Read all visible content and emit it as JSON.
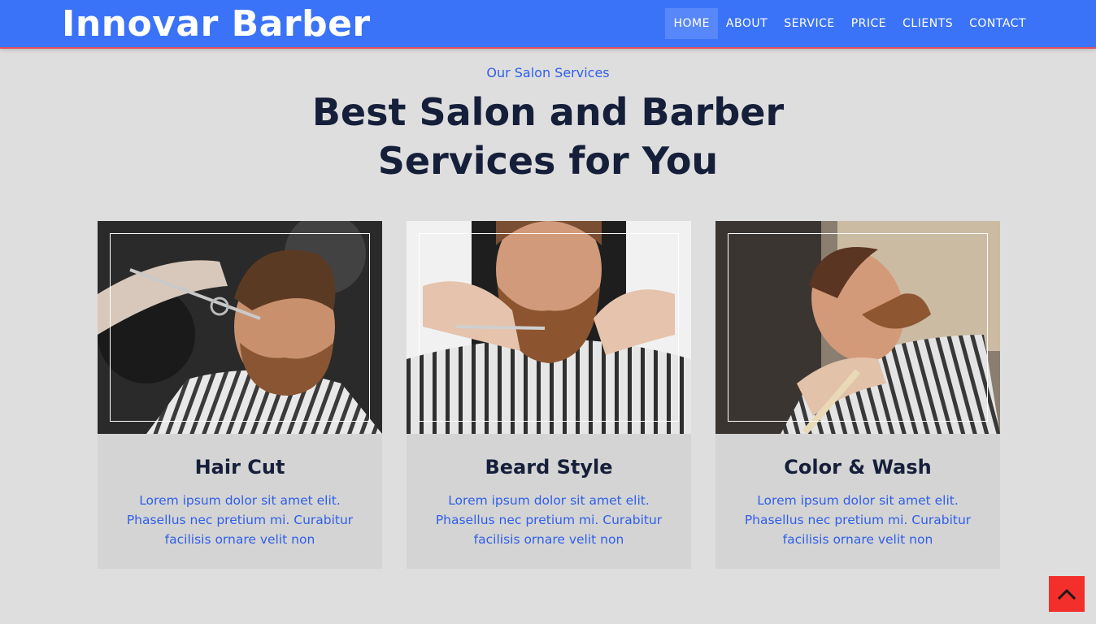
{
  "header": {
    "brand": "Innovar Barber",
    "nav": [
      "HOME",
      "ABOUT",
      "SERVICE",
      "PRICE",
      "CLIENTS",
      "CONTACT"
    ],
    "active": "HOME"
  },
  "section": {
    "eyebrow": "Our Salon Services",
    "title": "Best Salon and Barber Services for You"
  },
  "services": [
    {
      "title": "Hair Cut",
      "text": "Lorem ipsum dolor sit amet elit. Phasellus nec pretium mi. Curabitur facilisis ornare velit non",
      "image": "barber-cutting-hair-photo"
    },
    {
      "title": "Beard Style",
      "text": "Lorem ipsum dolor sit amet elit. Phasellus nec pretium mi. Curabitur facilisis ornare velit non",
      "image": "beard-trim-photo"
    },
    {
      "title": "Color & Wash",
      "text": "Lorem ipsum dolor sit amet elit. Phasellus nec pretium mi. Curabitur facilisis ornare velit non",
      "image": "beard-shaping-photo"
    }
  ],
  "back_to_top": {
    "icon": "chevron-up-icon"
  },
  "colors": {
    "navbar": "#3b73f8",
    "accent_text": "#2f5fe8",
    "heading_text": "#161f3a",
    "back_to_top": "#f22f2a",
    "page_bg": "#dedede",
    "card_bg": "#d4d4d4"
  }
}
